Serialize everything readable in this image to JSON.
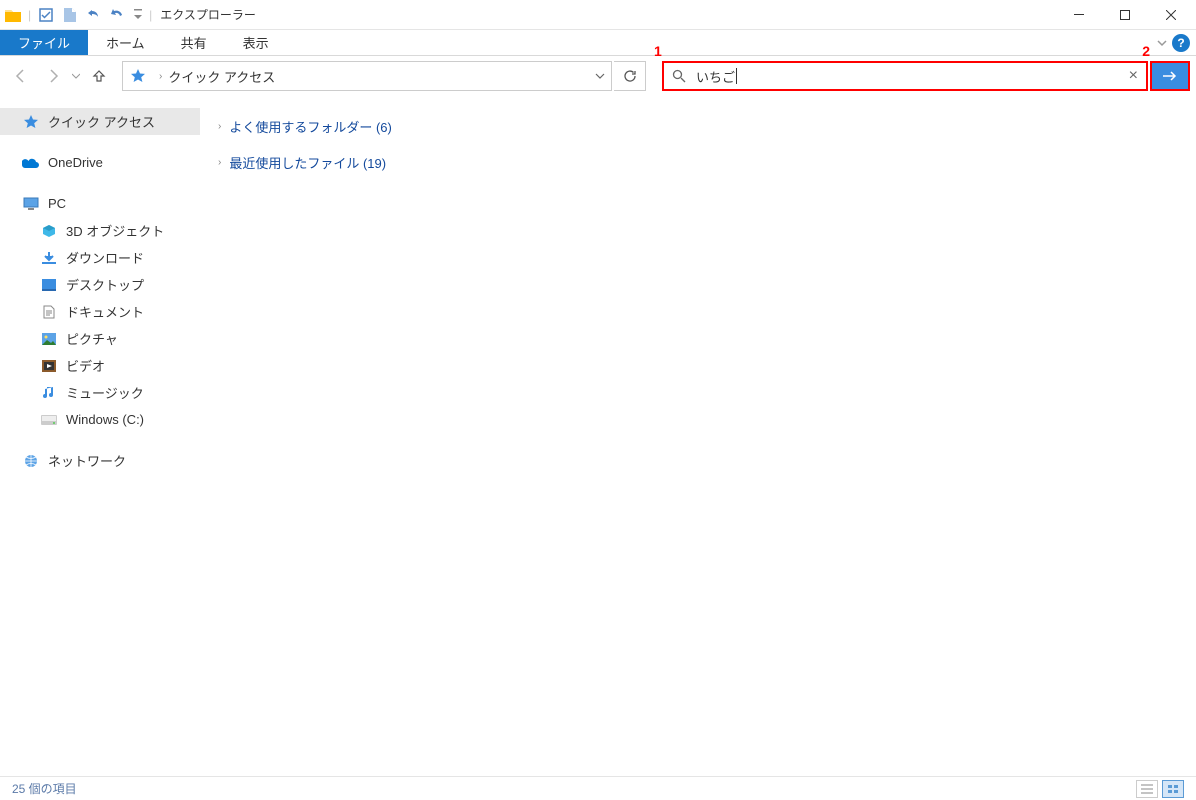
{
  "titlebar": {
    "title": "エクスプローラー"
  },
  "ribbon": {
    "file": "ファイル",
    "home": "ホーム",
    "share": "共有",
    "view": "表示"
  },
  "address": {
    "current": "クイック アクセス"
  },
  "search": {
    "value": "いちご"
  },
  "annotations": {
    "one": "1",
    "two": "2"
  },
  "sidebar": {
    "quick_access": "クイック アクセス",
    "onedrive": "OneDrive",
    "pc": "PC",
    "objects3d": "3D オブジェクト",
    "downloads": "ダウンロード",
    "desktop": "デスクトップ",
    "documents": "ドキュメント",
    "pictures": "ピクチャ",
    "videos": "ビデオ",
    "music": "ミュージック",
    "c_drive": "Windows (C:)",
    "network": "ネットワーク"
  },
  "content": {
    "folders_group": "よく使用するフォルダー (6)",
    "recent_group": "最近使用したファイル (19)"
  },
  "status": {
    "items": "25 個の項目"
  }
}
